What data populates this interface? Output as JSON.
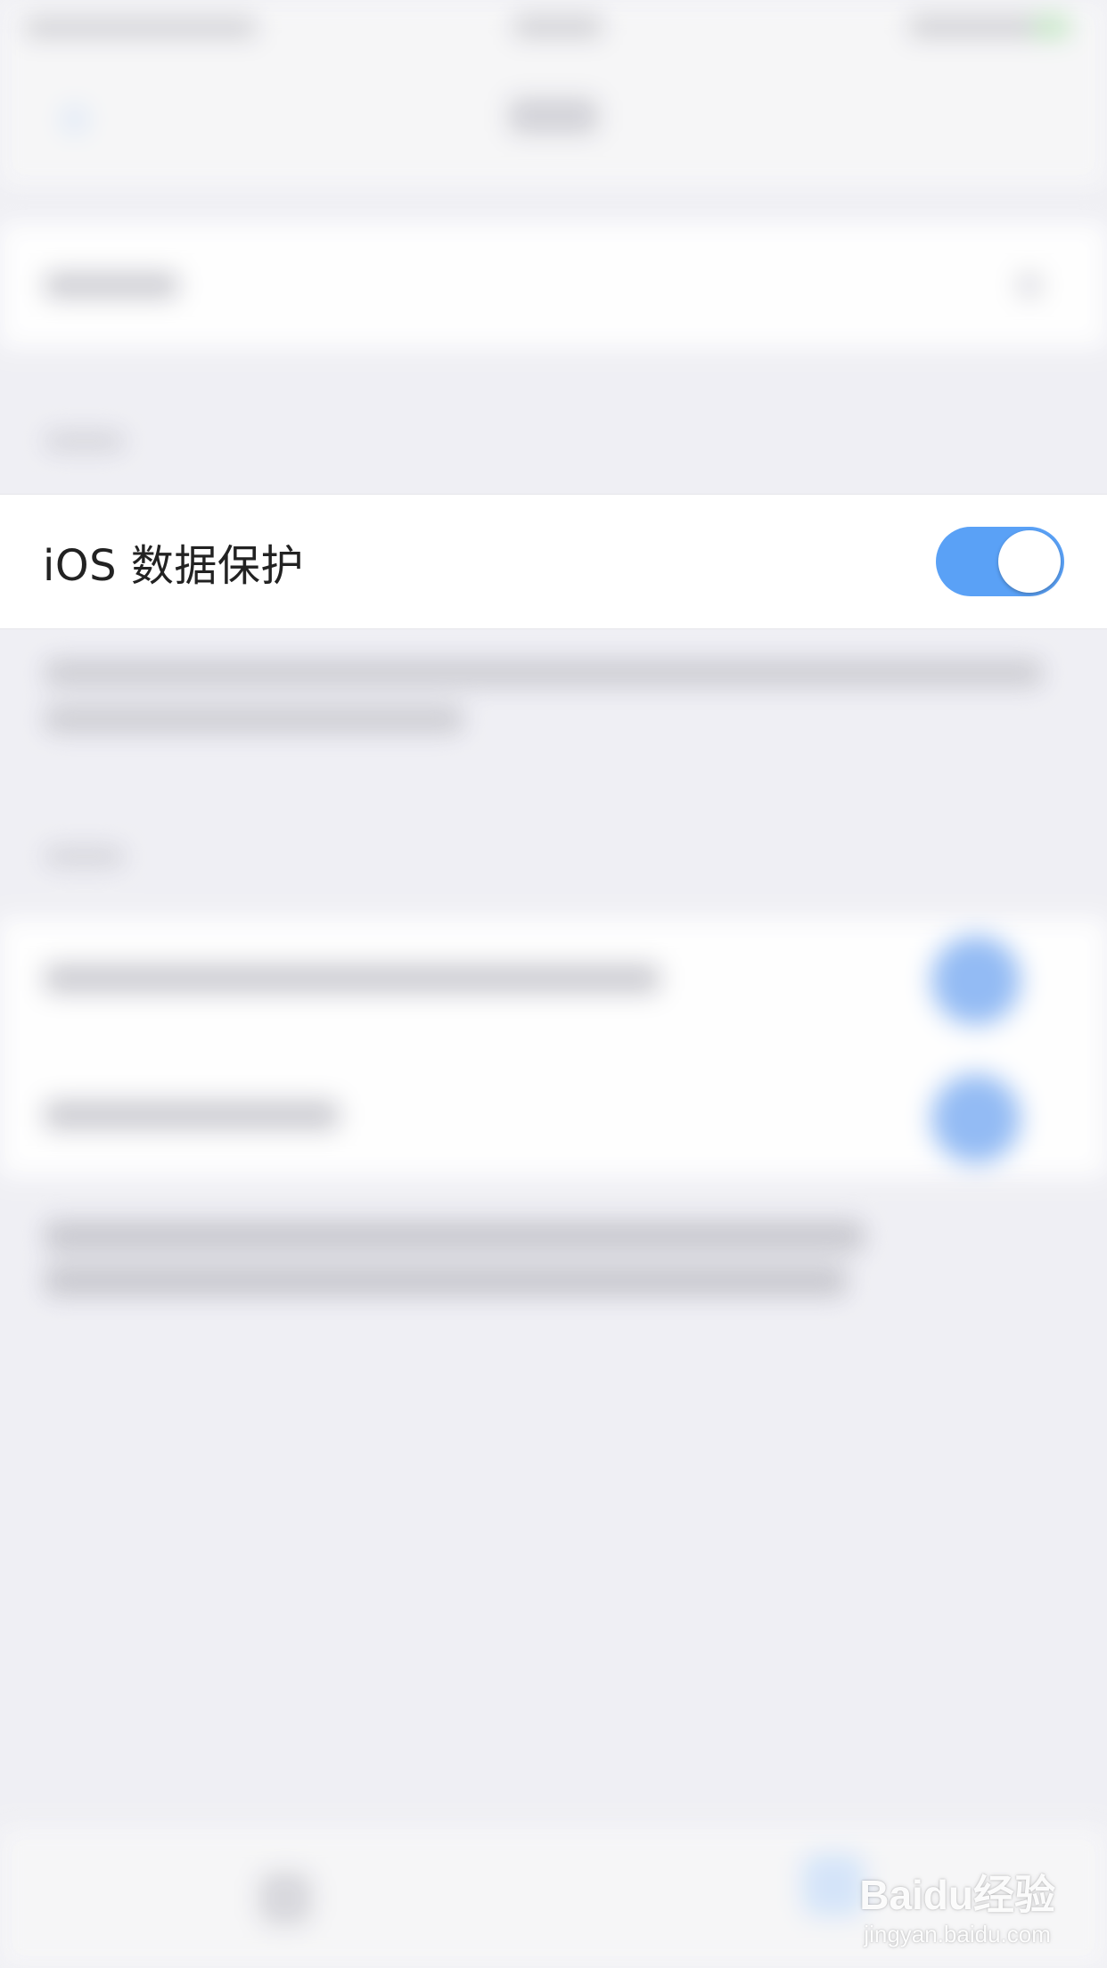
{
  "setting": {
    "label": "iOS 数据保护",
    "enabled": true
  },
  "colors": {
    "toggle_on": "#5aa1f6",
    "background": "#efeff4",
    "row": "#ffffff",
    "label_text": "#222222"
  },
  "icons": {
    "toggle": "toggle-switch",
    "watermark": "baidu-jingyan-logo"
  },
  "watermark": {
    "main": "Baidu经验",
    "sub": "jingyan.baidu.com"
  }
}
